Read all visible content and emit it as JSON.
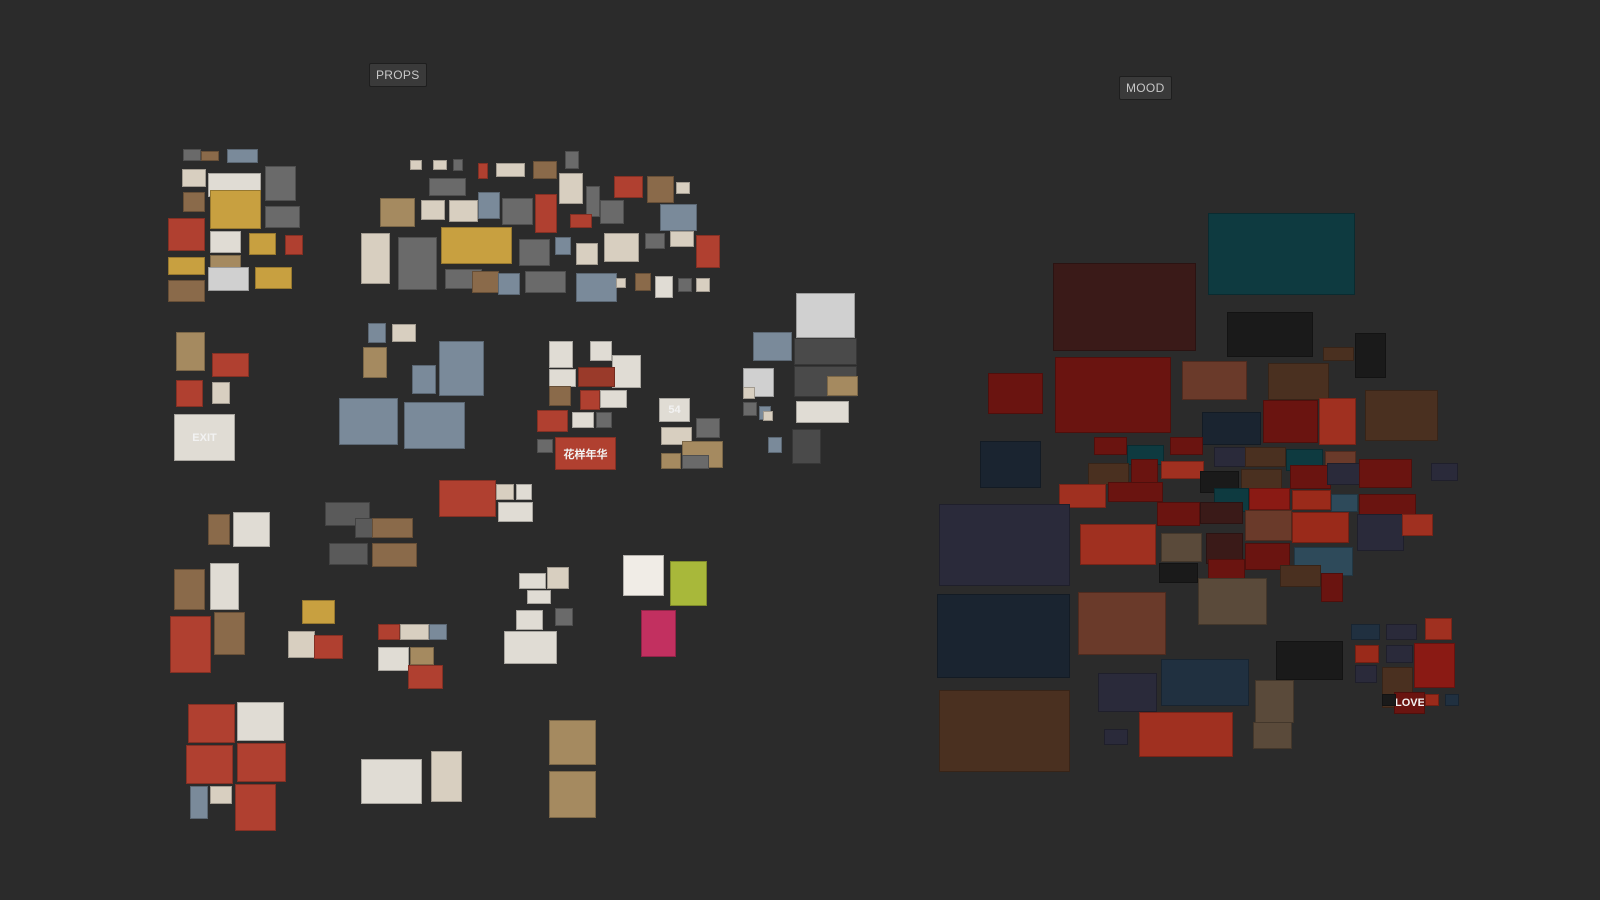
{
  "canvas": {
    "background": "#2b2b2b"
  },
  "groups": {
    "props": {
      "label": "PROPS"
    },
    "mood": {
      "label": "MOOD"
    }
  },
  "thumb_text": {
    "exit_sign": "EXIT",
    "number_tag": "54",
    "red_banner": "花样年华",
    "love_sign": "LOVE"
  },
  "palette": {
    "props": [
      "#8a6a4a",
      "#b8a58a",
      "#6a6a6a",
      "#c9c2b5",
      "#9a3a2a",
      "#d8cfc0",
      "#5a5a5a",
      "#a58a60",
      "#e0dcd4",
      "#7a8a9a",
      "#b04030",
      "#4a4a4a",
      "#c8a040",
      "#d0d0d0"
    ],
    "mood": [
      "#3a1a18",
      "#6a1410",
      "#9a2a1a",
      "#1a2430",
      "#0e3a40",
      "#2a2a3a",
      "#4a3020",
      "#8a1a14",
      "#1a1a1a",
      "#5a4a3a",
      "#2e4a5a",
      "#6a3a2a",
      "#a03020",
      "#203040"
    ]
  }
}
